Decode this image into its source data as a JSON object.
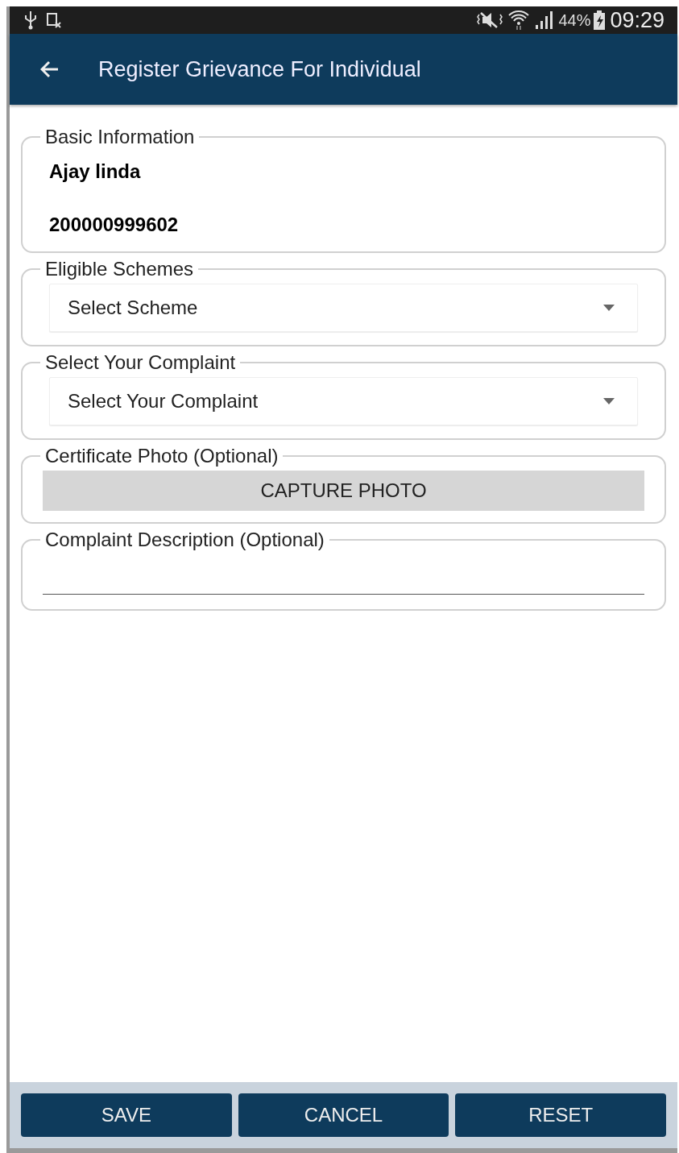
{
  "status_bar": {
    "battery_percent": "44%",
    "time": "09:29"
  },
  "app_bar": {
    "title": "Register Grievance For Individual"
  },
  "sections": [
    {
      "kind": "info",
      "legend": "Basic Information",
      "lines": [
        "Ajay linda",
        "200000999602"
      ]
    },
    {
      "kind": "select",
      "legend": "Eligible Schemes",
      "value": "Select Scheme"
    },
    {
      "kind": "select",
      "legend": "Select Your Complaint",
      "value": "Select Your Complaint"
    },
    {
      "kind": "button",
      "legend": "Certificate Photo (Optional)",
      "label": "CAPTURE PHOTO"
    },
    {
      "kind": "text",
      "legend": "Complaint Description (Optional)"
    }
  ],
  "buttons": [
    "SAVE",
    "CANCEL",
    "RESET"
  ]
}
